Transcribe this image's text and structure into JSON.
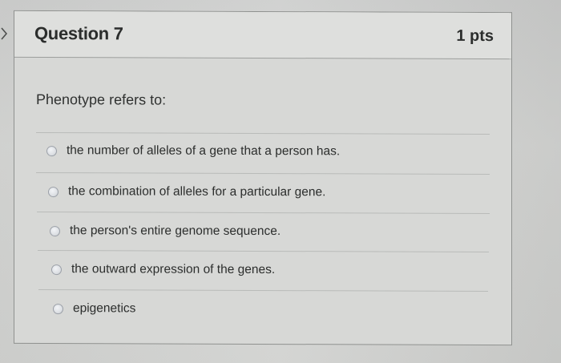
{
  "question": {
    "title": "Question 7",
    "points": "1 pts",
    "prompt": "Phenotype refers to:"
  },
  "answers": [
    {
      "label": "the number of alleles of a gene that a person has.",
      "selected": false
    },
    {
      "label": "the combination of alleles for a particular gene.",
      "selected": false
    },
    {
      "label": "the person's entire genome sequence.",
      "selected": false
    },
    {
      "label": "the outward expression of the genes.",
      "selected": false
    },
    {
      "label": "epigenetics",
      "selected": false
    }
  ],
  "icons": {
    "collapse": "chevron-right-icon",
    "option": "radio-button-icon"
  }
}
